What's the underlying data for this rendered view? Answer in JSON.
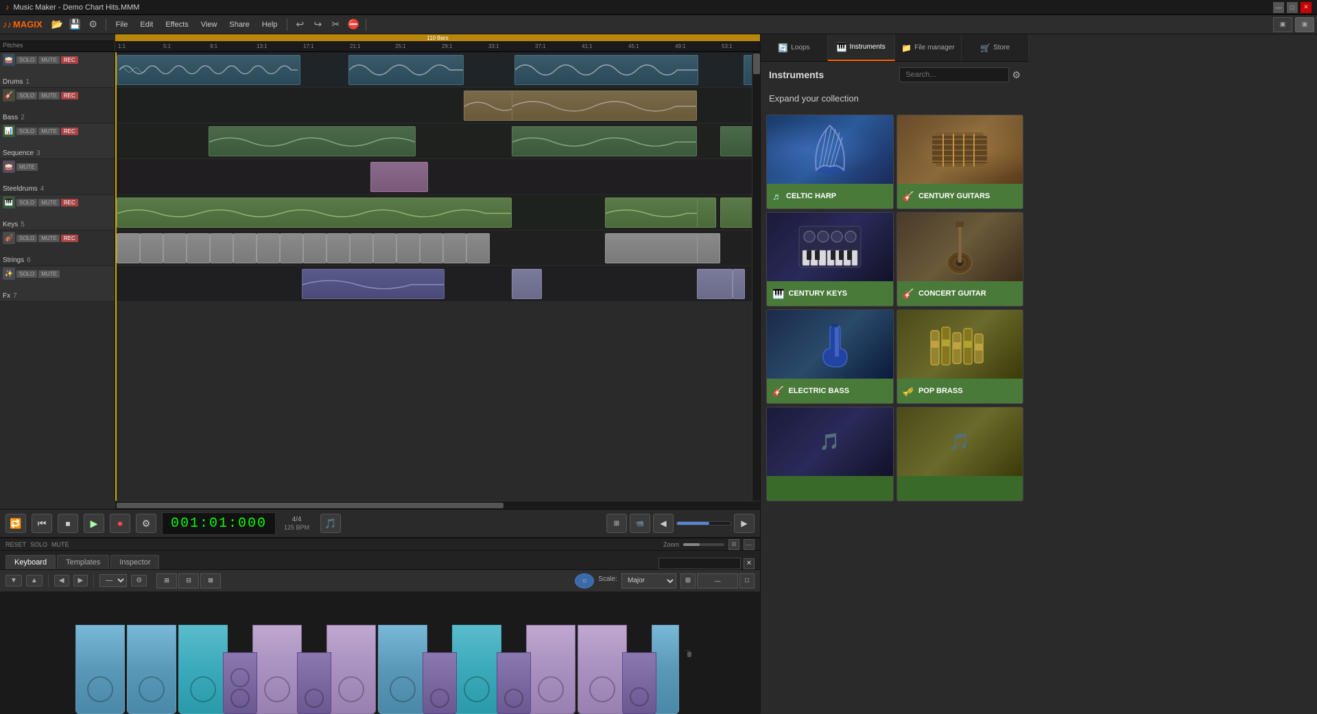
{
  "titlebar": {
    "title": "Music Maker - Demo Chart Hits.MMM",
    "icon": "♪",
    "min_btn": "—",
    "max_btn": "□",
    "close_btn": "✕"
  },
  "menubar": {
    "logo": "MAGIX",
    "items": [
      "File",
      "Edit",
      "Effects",
      "View",
      "Share",
      "Help"
    ]
  },
  "toolbar": {
    "icons": [
      "📁",
      "💾",
      "↩",
      "↪",
      "✂",
      "⛔"
    ]
  },
  "timeline": {
    "total_bars": "110 Bars",
    "bars": [
      "1:1",
      "5:1",
      "9:1",
      "13:1",
      "17:1",
      "21:1",
      "25:1",
      "29:1",
      "33:1",
      "37:1",
      "41:1",
      "45:1",
      "49:1",
      "53:1"
    ]
  },
  "tracks": [
    {
      "id": 1,
      "name": "Drums",
      "num": "1",
      "controls": [
        "SOLO",
        "MUTE",
        "REC"
      ],
      "type": "drums"
    },
    {
      "id": 2,
      "name": "Bass",
      "num": "2",
      "controls": [
        "SOLO",
        "MUTE",
        "REC"
      ],
      "type": "bass"
    },
    {
      "id": 3,
      "name": "Sequence",
      "num": "3",
      "controls": [
        "SOLO",
        "MUTE",
        "REC"
      ],
      "type": "sequence"
    },
    {
      "id": 4,
      "name": "Steeldrums",
      "num": "4",
      "controls": [
        "MUTE"
      ],
      "type": "steeldrums"
    },
    {
      "id": 5,
      "name": "Keys",
      "num": "5",
      "controls": [
        "SOLO",
        "MUTE",
        "REC"
      ],
      "type": "keys"
    },
    {
      "id": 6,
      "name": "Strings",
      "num": "6",
      "controls": [
        "SOLO",
        "MUTE",
        "REC"
      ],
      "type": "strings"
    },
    {
      "id": 7,
      "name": "Fx",
      "num": "7",
      "controls": [
        "SOLO",
        "MUTE"
      ],
      "type": "fx"
    }
  ],
  "transport": {
    "time": "001:01:000",
    "time_sig": "4/4",
    "bpm": "125 BPM",
    "buttons": [
      "loop",
      "rewind",
      "stop",
      "play",
      "record",
      "settings"
    ]
  },
  "keyboard_panel": {
    "tabs": [
      "Keyboard",
      "Templates",
      "Inspector"
    ],
    "active_tab": "Keyboard",
    "scale_label": "Scale:",
    "scale_value": "Major",
    "search_placeholder": ""
  },
  "piano_keys": [
    {
      "type": "white",
      "color": "blue"
    },
    {
      "type": "white",
      "color": "blue"
    },
    {
      "type": "white",
      "color": "teal"
    },
    {
      "type": "black",
      "color": "purple"
    },
    {
      "type": "white",
      "color": "purple"
    },
    {
      "type": "black",
      "color": "purple"
    },
    {
      "type": "white",
      "color": "purple"
    },
    {
      "type": "white",
      "color": "blue"
    },
    {
      "type": "black",
      "color": "purple"
    },
    {
      "type": "white",
      "color": "blue"
    },
    {
      "type": "black",
      "color": "purple"
    },
    {
      "type": "white",
      "color": "purple"
    },
    {
      "type": "white",
      "color": "purple"
    },
    {
      "type": "black",
      "color": "purple"
    },
    {
      "type": "white",
      "color": "blue"
    }
  ],
  "right_panel": {
    "tabs": [
      {
        "id": "loops",
        "label": "Loops",
        "icon": "🔄"
      },
      {
        "id": "instruments",
        "label": "Instruments",
        "icon": "🎹"
      },
      {
        "id": "file_manager",
        "label": "File manager",
        "icon": "📁"
      },
      {
        "id": "store",
        "label": "Store",
        "icon": "🛒"
      }
    ],
    "active_tab": "instruments",
    "title": "Instruments",
    "search_placeholder": "Search...",
    "settings_icon": "⚙",
    "expand_title": "Expand your collection",
    "instruments": [
      {
        "id": "celtic_harp",
        "name": "CELTIC HARP",
        "icon": "🎵",
        "label_color": "green",
        "thumb": "blue",
        "highlighted": true
      },
      {
        "id": "century_guitars",
        "name": "CENTURY GUITARS",
        "icon": "🎸",
        "label_color": "green",
        "thumb": "guitar"
      },
      {
        "id": "century_keys",
        "name": "CENTURY KEYS",
        "icon": "🎹",
        "label_color": "green",
        "thumb": "synth"
      },
      {
        "id": "concert_guitar",
        "name": "CONCERT GUITAR",
        "icon": "🎸",
        "label_color": "green",
        "thumb": "acoustic"
      },
      {
        "id": "electric_bass",
        "name": "ELECTRIC BASS",
        "icon": "🎸",
        "label_color": "green",
        "thumb": "bass"
      },
      {
        "id": "pop_brass",
        "name": "POP BRASS",
        "icon": "🎺",
        "label_color": "green",
        "thumb": "brass"
      },
      {
        "id": "more1",
        "name": "",
        "icon": "",
        "label_color": "green",
        "thumb": "keys"
      },
      {
        "id": "more2",
        "name": "",
        "icon": "",
        "label_color": "green",
        "thumb": "keys"
      }
    ]
  },
  "bottom_bar": {
    "reset_label": "RESET",
    "solo_label": "SOLO",
    "mute_label": "MUTE",
    "zoom_label": "Zoom"
  }
}
